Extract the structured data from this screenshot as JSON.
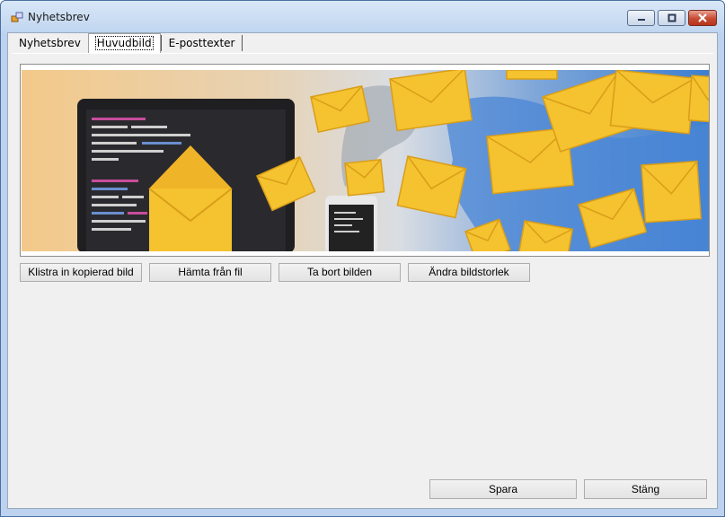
{
  "window": {
    "title": "Nyhetsbrev"
  },
  "title_controls": {
    "minimize": "minimize-icon",
    "maximize": "maximize-icon",
    "close": "close-icon"
  },
  "tabs": [
    {
      "label": "Nyhetsbrev"
    },
    {
      "label": "Huvudbild"
    },
    {
      "label": "E-posttexter"
    }
  ],
  "selected_tab": "Huvudbild",
  "image_actions": {
    "paste": "Klistra in kopierad bild",
    "load": "Hämta från fil",
    "remove": "Ta bort bilden",
    "resize": "Ändra bildstorlek"
  },
  "footer": {
    "save": "Spara",
    "close": "Stäng"
  },
  "colors": {
    "accent_close": "#c84a32",
    "envelope": "#f5c230",
    "map_blue": "#4a86d6"
  }
}
